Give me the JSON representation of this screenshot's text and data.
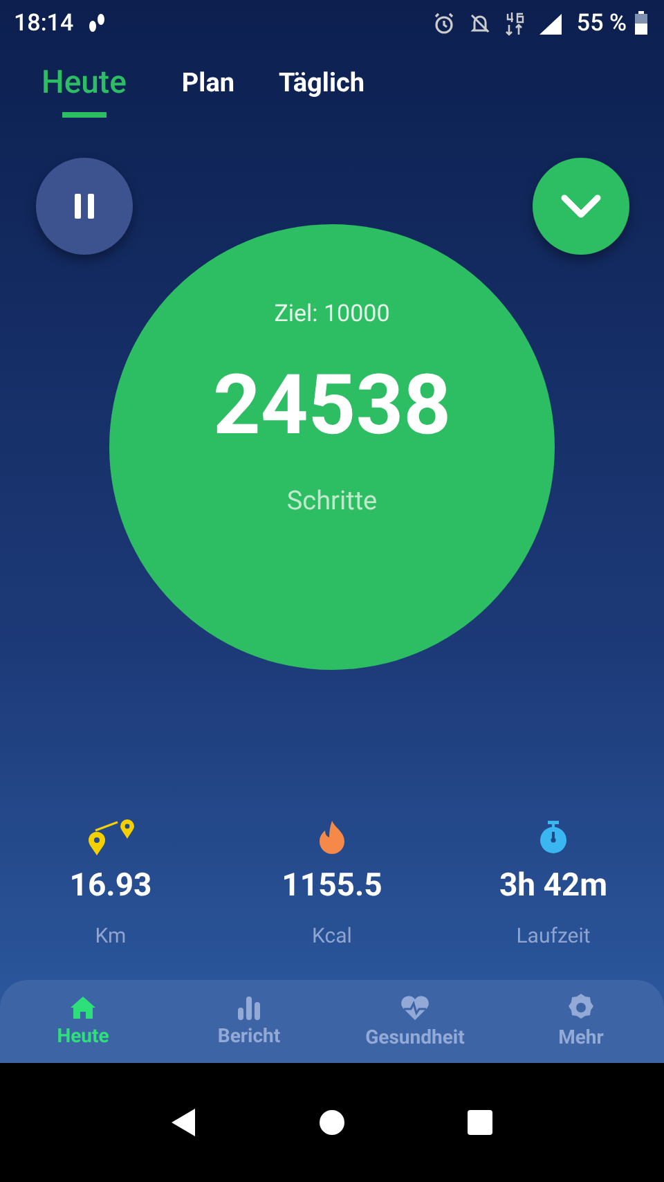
{
  "status_bar": {
    "time": "18:14",
    "battery": "55 %"
  },
  "tabs": [
    {
      "label": "Heute",
      "selected": true
    },
    {
      "label": "Plan",
      "selected": false
    },
    {
      "label": "Täglich",
      "selected": false
    }
  ],
  "goal": "Ziel: 10000",
  "steps": "24538",
  "steps_label": "Schritte",
  "stats": [
    {
      "kind": "distance",
      "value": "16.93",
      "unit": "Km"
    },
    {
      "kind": "calories",
      "value": "1155.5",
      "unit": "Kcal"
    },
    {
      "kind": "time",
      "value": "3h 42m",
      "unit": "Laufzeit"
    }
  ],
  "nav": [
    {
      "kind": "home",
      "label": "Heute",
      "selected": true
    },
    {
      "kind": "report",
      "label": "Bericht",
      "selected": false
    },
    {
      "kind": "health",
      "label": "Gesundheit",
      "selected": false
    },
    {
      "kind": "more",
      "label": "Mehr",
      "selected": false
    }
  ]
}
